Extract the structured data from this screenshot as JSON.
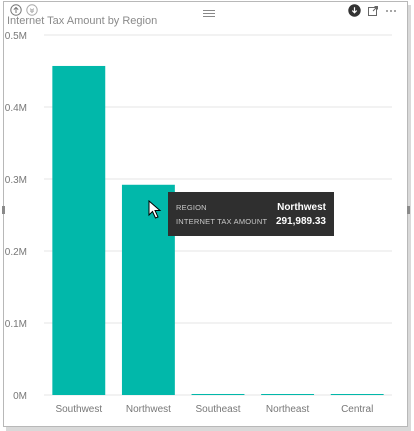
{
  "visual": {
    "title": "Internet Tax Amount by Region"
  },
  "toolbar": {
    "icons": [
      "drill-up-icon",
      "drill-down-icon",
      "focus-mode-icon",
      "download-icon",
      "expand-icon",
      "more-options-icon"
    ]
  },
  "colors": {
    "bar": "#01B8AA",
    "grid": "#e6e6e6",
    "axis_text": "#777777",
    "tooltip_bg": "#2f2f2f"
  },
  "tooltip": {
    "region_label": "REGION",
    "region_value": "Northwest",
    "amount_label": "INTERNET TAX AMOUNT",
    "amount_value": "291,989.33"
  },
  "chart_data": {
    "type": "bar",
    "title": "Internet Tax Amount by Region",
    "categories": [
      "Southwest",
      "Northwest",
      "Southeast",
      "Northeast",
      "Central"
    ],
    "values": [
      457000,
      291989.33,
      1400,
      700,
      350
    ],
    "ylim": [
      0,
      500000
    ],
    "yticks": [
      0,
      100000,
      200000,
      300000,
      400000,
      500000
    ],
    "ytick_labels": [
      "0M",
      "0.1M",
      "0.2M",
      "0.3M",
      "0.4M",
      "0.5M"
    ],
    "xlabel": "",
    "ylabel": "",
    "grid": true,
    "legend": "none"
  }
}
